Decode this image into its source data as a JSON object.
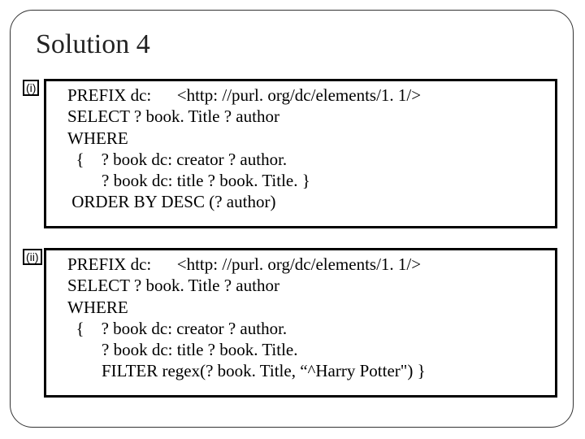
{
  "title": "Solution 4",
  "parts": [
    {
      "label": "(i)",
      "code": "PREFIX dc:      <http: //purl. org/dc/elements/1. 1/>\nSELECT ? book. Title ? author\nWHERE\n  {    ? book dc: creator ? author.\n        ? book dc: title ? book. Title. }\n ORDER BY DESC (? author)"
    },
    {
      "label": "(ii)",
      "code": "PREFIX dc:      <http: //purl. org/dc/elements/1. 1/>\nSELECT ? book. Title ? author\nWHERE\n  {    ? book dc: creator ? author.\n        ? book dc: title ? book. Title.\n        FILTER regex(? book. Title, “^Harry Potter\") }"
    }
  ]
}
